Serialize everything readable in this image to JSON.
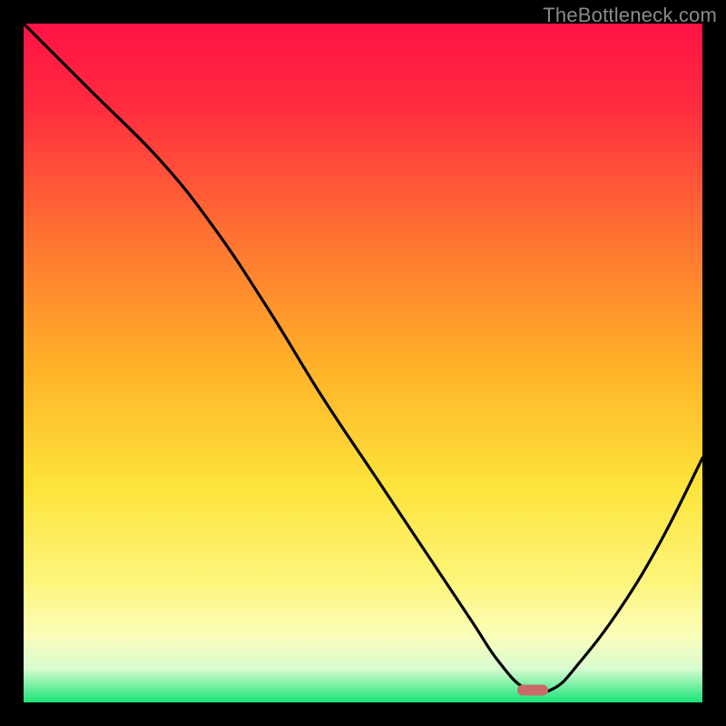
{
  "watermark": "TheBottleneck.com",
  "chart_data": {
    "type": "line",
    "title": "",
    "xlabel": "",
    "ylabel": "",
    "xlim": [
      0,
      100
    ],
    "ylim": [
      0,
      100
    ],
    "x": [
      0,
      10,
      20,
      28,
      36,
      44,
      52,
      60,
      66,
      70,
      74,
      78,
      82,
      88,
      94,
      100
    ],
    "values": [
      100,
      90,
      80,
      70,
      58,
      45,
      33,
      21,
      12,
      6,
      2,
      2,
      6,
      14,
      24,
      36
    ],
    "marker": {
      "x": 75,
      "y": 1.8,
      "color": "#c86a6a"
    },
    "background_gradient": {
      "stops": [
        {
          "pct": 0,
          "color": "#ff1345"
        },
        {
          "pct": 12,
          "color": "#ff2b3f"
        },
        {
          "pct": 30,
          "color": "#ff6e33"
        },
        {
          "pct": 50,
          "color": "#ffb028"
        },
        {
          "pct": 68,
          "color": "#fde33a"
        },
        {
          "pct": 82,
          "color": "#fdf57a"
        },
        {
          "pct": 90,
          "color": "#fbfdb8"
        },
        {
          "pct": 95,
          "color": "#d9fcd0"
        },
        {
          "pct": 100,
          "color": "#17e476"
        }
      ]
    }
  }
}
